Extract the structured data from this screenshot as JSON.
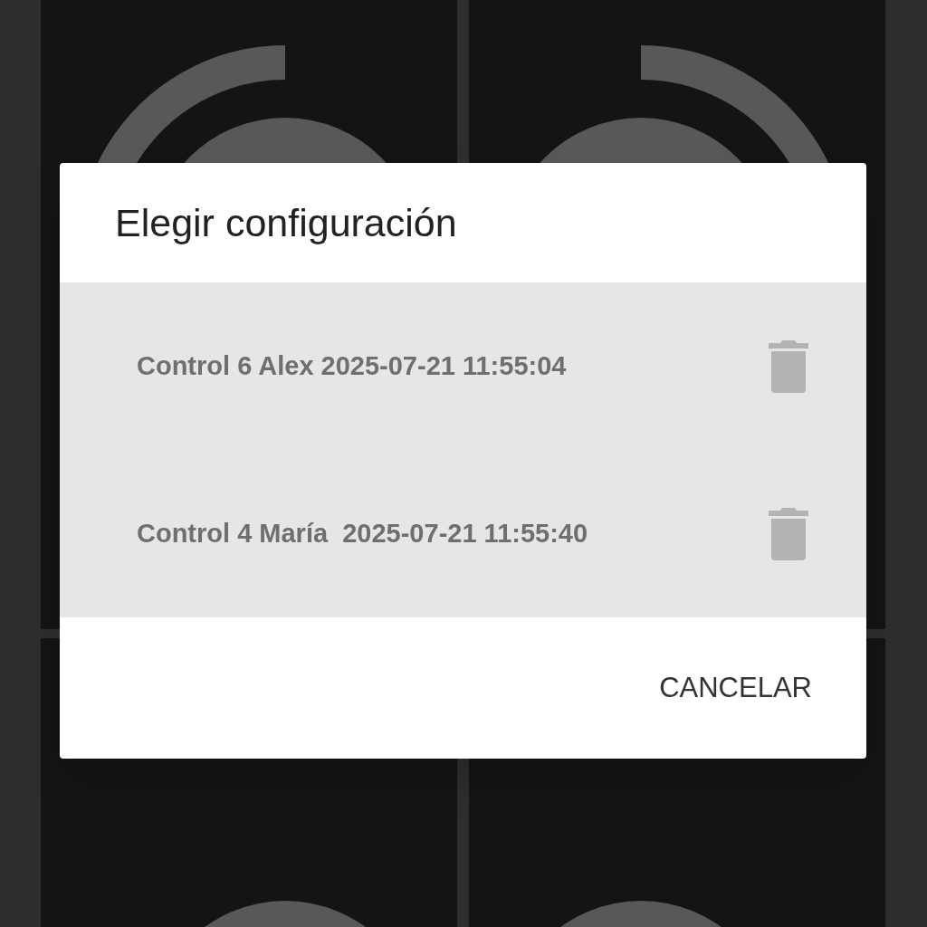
{
  "dialog": {
    "title": "Elegir configuración",
    "items": [
      {
        "label": "Control 6 Alex 2025-07-21 11:55:04"
      },
      {
        "label": "Control 4 María  2025-07-21 11:55:40"
      }
    ],
    "buttons": [
      "CANCELAR"
    ]
  }
}
